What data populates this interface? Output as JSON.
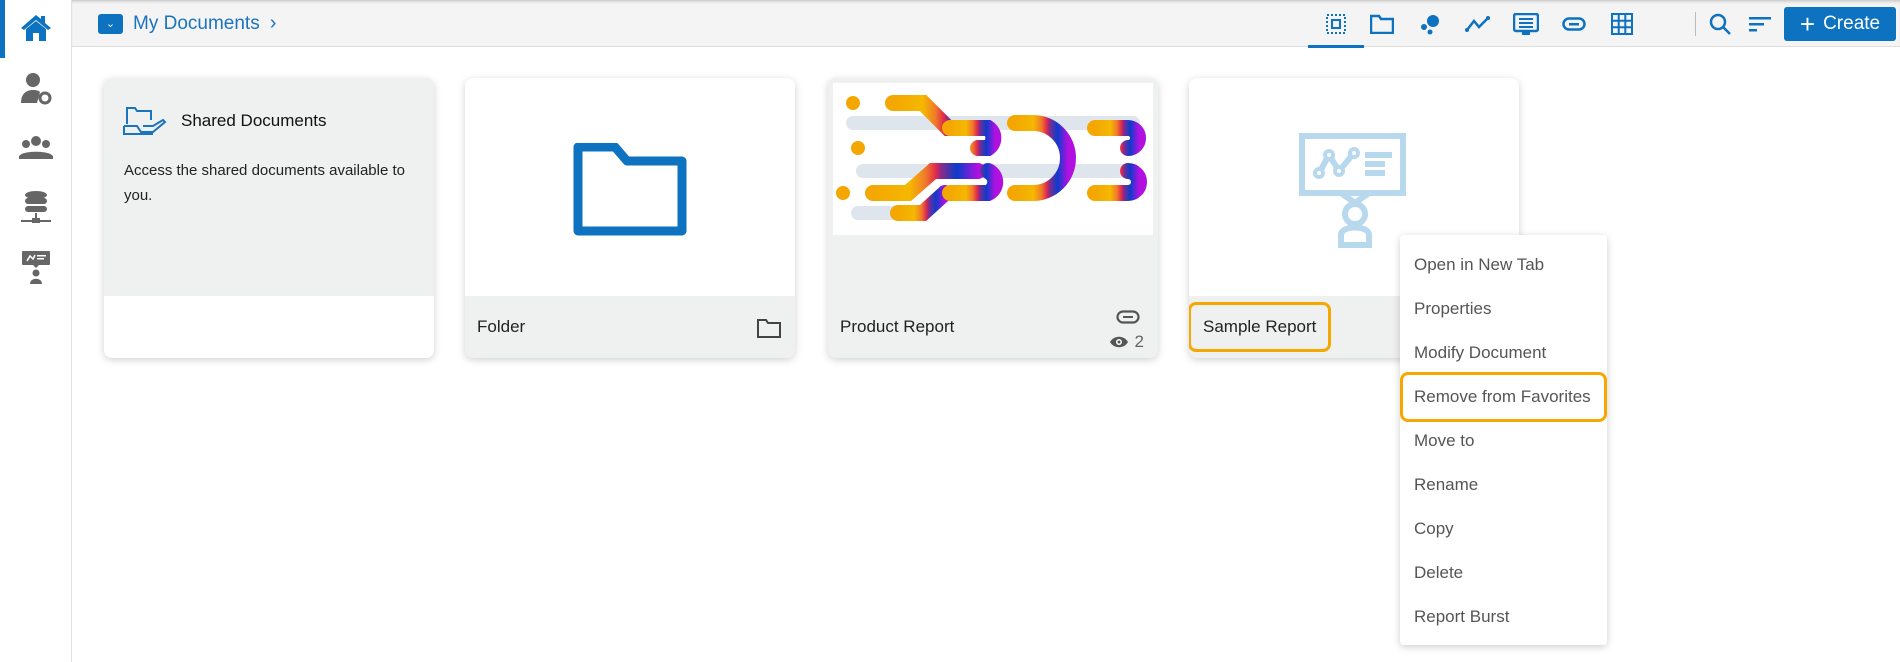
{
  "breadcrumb": {
    "label": "My Documents"
  },
  "toolbar": {
    "create_label": "Create"
  },
  "cards": [
    {
      "title": "Shared Documents",
      "description": "Access the shared documents available to you."
    },
    {
      "title": "Folder"
    },
    {
      "title": "Product Report",
      "views": "2"
    },
    {
      "title": "Sample Report"
    }
  ],
  "context_menu": {
    "items": [
      "Open in New Tab",
      "Properties",
      "Modify Document",
      "Remove from Favorites",
      "Move to",
      "Rename",
      "Copy",
      "Delete",
      "Report Burst"
    ]
  },
  "colors": {
    "accent": "#0d72bf",
    "highlight": "#f5a800"
  }
}
